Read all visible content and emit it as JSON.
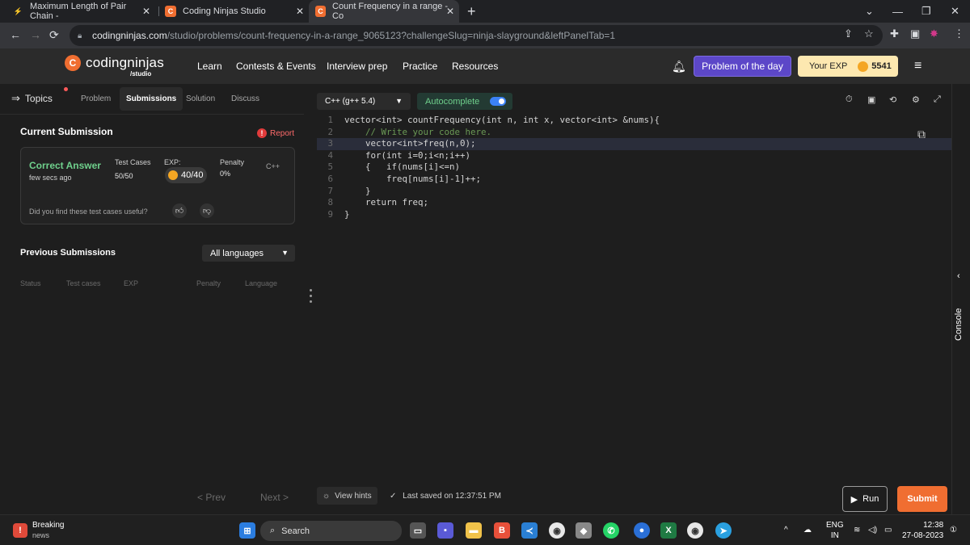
{
  "browser": {
    "tabs": [
      {
        "title": "Maximum Length of Pair Chain -",
        "active": false
      },
      {
        "title": "Coding Ninjas Studio",
        "active": false
      },
      {
        "title": "Count Frequency in a range - Co",
        "active": true
      }
    ],
    "url_host": "codingninjas.com",
    "url_path": "/studio/problems/count-frequency-in-a-range_9065123?challengeSlug=ninja-slayground&leftPanelTab=1"
  },
  "header": {
    "logo_text": "codingninjas",
    "logo_sub": "/studio",
    "nav": [
      "Learn",
      "Contests & Events",
      "Interview prep",
      "Practice",
      "Resources"
    ],
    "potd": "Problem of the day",
    "exp_label": "Your EXP",
    "exp_value": "5541"
  },
  "left": {
    "topics": "Topics",
    "tabs": [
      "Problem",
      "Submissions",
      "Solution",
      "Discuss"
    ],
    "active_tab": "Submissions",
    "current_submission_title": "Current Submission",
    "report": "Report",
    "submission": {
      "status": "Correct Answer",
      "time": "few secs ago",
      "test_cases_label": "Test Cases",
      "test_cases_value": "50/50",
      "exp_label": "EXP:",
      "exp_value": "40/40",
      "penalty_label": "Penalty",
      "penalty_value": "0%",
      "language": "C++",
      "useful_prompt": "Did you find these test cases useful?"
    },
    "previous_title": "Previous Submissions",
    "language_filter": "All languages",
    "prev_headers": [
      "Status",
      "Test cases",
      "EXP",
      "Penalty",
      "Language"
    ],
    "prev_btn": "< Prev",
    "next_btn": "Next >"
  },
  "editor": {
    "language": "C++ (g++ 5.4)",
    "autocomplete": "Autocomplete",
    "line_numbers": [
      "1",
      "2",
      "3",
      "4",
      "5",
      "6",
      "7",
      "8",
      "9"
    ],
    "code_lines": [
      "vector<int> countFrequency(int n, int x, vector<int> &nums){",
      "    // Write your code here.",
      "    vector<int>freq(n,0);",
      "    for(int i=0;i<n;i++)",
      "    {   if(nums[i]<=n)",
      "        freq[nums[i]-1]++;",
      "    }",
      "    return freq;",
      "}"
    ],
    "view_hints": "View hints",
    "last_saved": "Last saved on 12:37:51 PM",
    "run": "Run",
    "submit": "Submit"
  },
  "console_label": "Console",
  "taskbar": {
    "news_title": "Breaking",
    "news_sub": "news",
    "search": "Search",
    "lang_top": "ENG",
    "lang_bottom": "IN",
    "time": "12:38",
    "date": "27-08-2023"
  },
  "colors": {
    "accent_orange": "#f06e31",
    "potd_purple": "#5c47c8",
    "success_green": "#6fd08c"
  }
}
